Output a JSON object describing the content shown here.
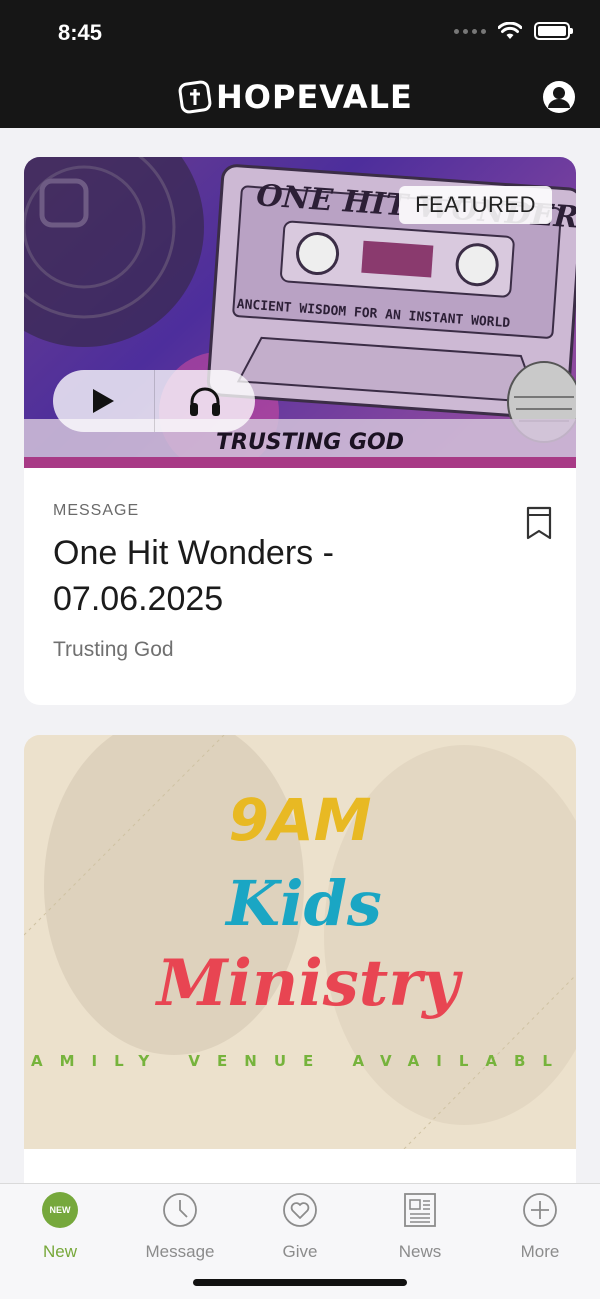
{
  "status_bar": {
    "time": "8:45"
  },
  "header": {
    "brand": "HOPEVALE"
  },
  "featured_card": {
    "badge": "FEATURED",
    "artwork": {
      "series_text": "ONE HIT WONDERS",
      "tagline": "ANCIENT WISDOM FOR AN INSTANT WORLD",
      "sermon_text": "TRUSTING GOD"
    },
    "type": "MESSAGE",
    "title": "One Hit Wonders - 07.06.2025",
    "subtitle": "Trusting God"
  },
  "second_card": {
    "artwork": {
      "line1": "9AM",
      "line2": "Kids",
      "line3": "Ministry",
      "footer": "AMILY VENUE AVAILABL"
    }
  },
  "tabbar": {
    "items": [
      {
        "label": "New",
        "icon": "new-badge-icon",
        "badge": "NEW",
        "active": true
      },
      {
        "label": "Message",
        "icon": "clock-icon",
        "active": false
      },
      {
        "label": "Give",
        "icon": "heart-icon",
        "active": false
      },
      {
        "label": "News",
        "icon": "newspaper-icon",
        "active": false
      },
      {
        "label": "More",
        "icon": "plus-circle-icon",
        "active": false
      }
    ]
  },
  "colors": {
    "accent": "#76a83c",
    "header_bg": "#161616"
  }
}
